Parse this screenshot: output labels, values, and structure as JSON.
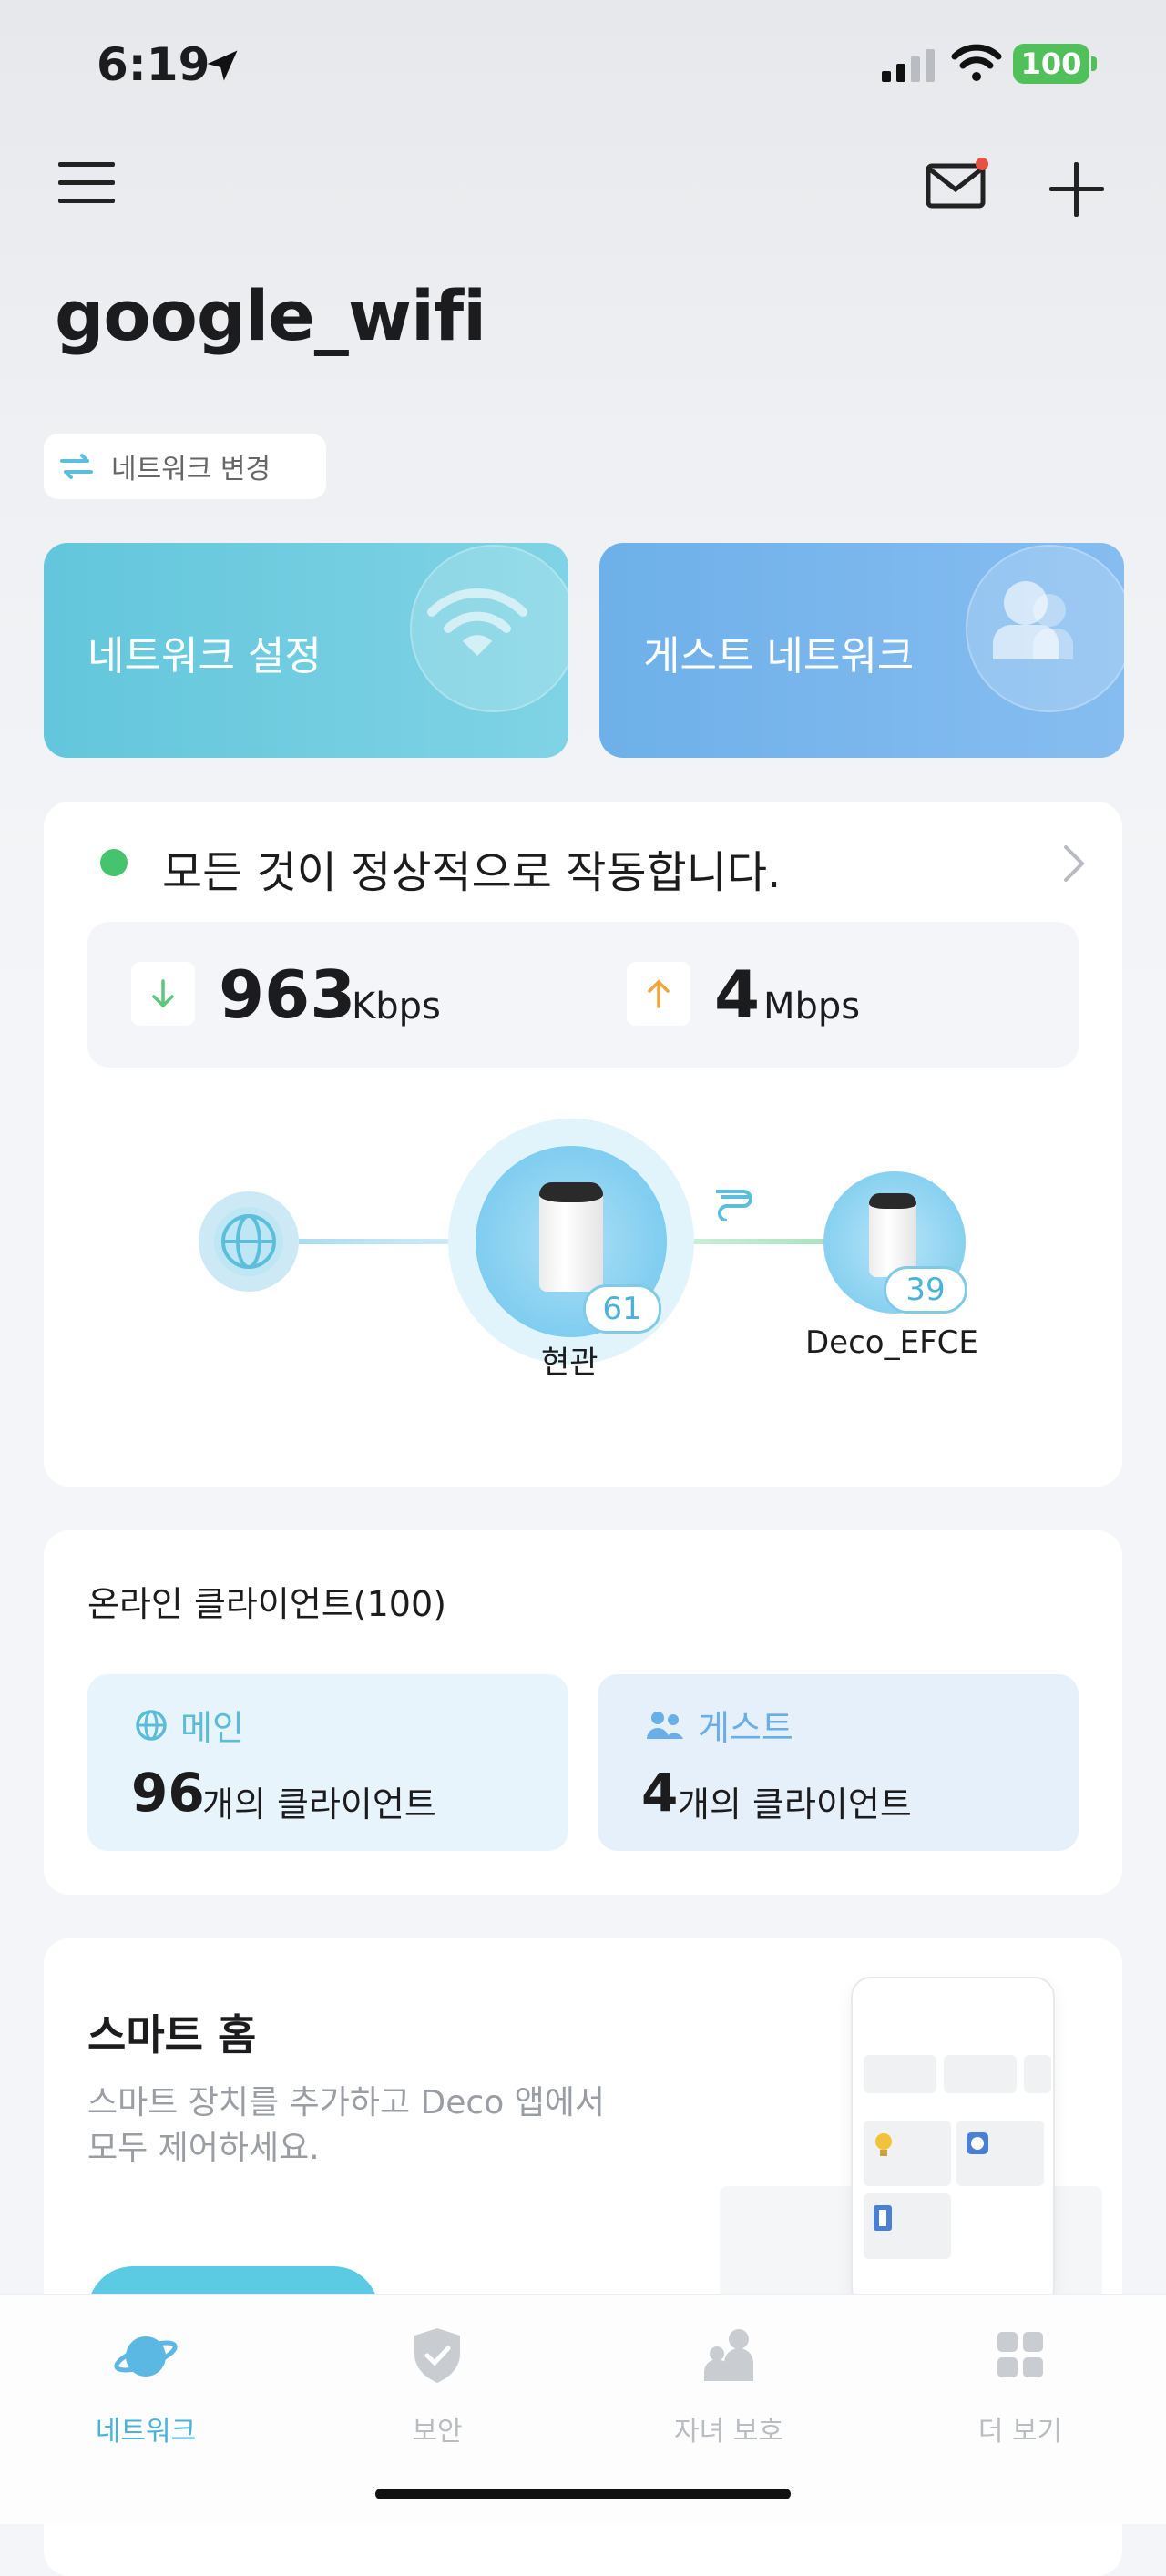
{
  "status_bar": {
    "time": "6:19",
    "battery": "100"
  },
  "header": {
    "title": "google_wifi",
    "switch_network_label": "네트워크 변경"
  },
  "quick_cards": {
    "network_settings": "네트워크 설정",
    "guest_network": "게스트 네트워크"
  },
  "status": {
    "message": "모든 것이 정상적으로 작동합니다."
  },
  "speed": {
    "download_value": "963",
    "download_unit": "Kbps",
    "upload_value": "4",
    "upload_unit": "Mbps"
  },
  "topology": {
    "main_node": {
      "label": "현관",
      "clients": "61"
    },
    "satellite_node": {
      "label": "Deco_EFCE",
      "clients": "39"
    }
  },
  "clients": {
    "title": "온라인 클라이언트(100)",
    "main": {
      "label": "메인",
      "count": "96",
      "suffix": "개의 클라이언트"
    },
    "guest": {
      "label": "게스트",
      "count": "4",
      "suffix": "개의 클라이언트"
    }
  },
  "smart_home": {
    "title": "스마트 홈",
    "description_line1": "스마트 장치를 추가하고 Deco 앱에서",
    "description_line2": "모두 제어하세요."
  },
  "tabs": [
    {
      "label": "네트워크",
      "icon": "planet-icon",
      "active": true
    },
    {
      "label": "보안",
      "icon": "shield-icon",
      "active": false
    },
    {
      "label": "자녀 보호",
      "icon": "family-icon",
      "active": false
    },
    {
      "label": "더 보기",
      "icon": "grid-icon",
      "active": false
    }
  ],
  "colors": {
    "accent": "#47b3dc",
    "status_ok": "#46c46d",
    "network_card": "#63c6dc",
    "guest_card": "#6eb0e9"
  }
}
